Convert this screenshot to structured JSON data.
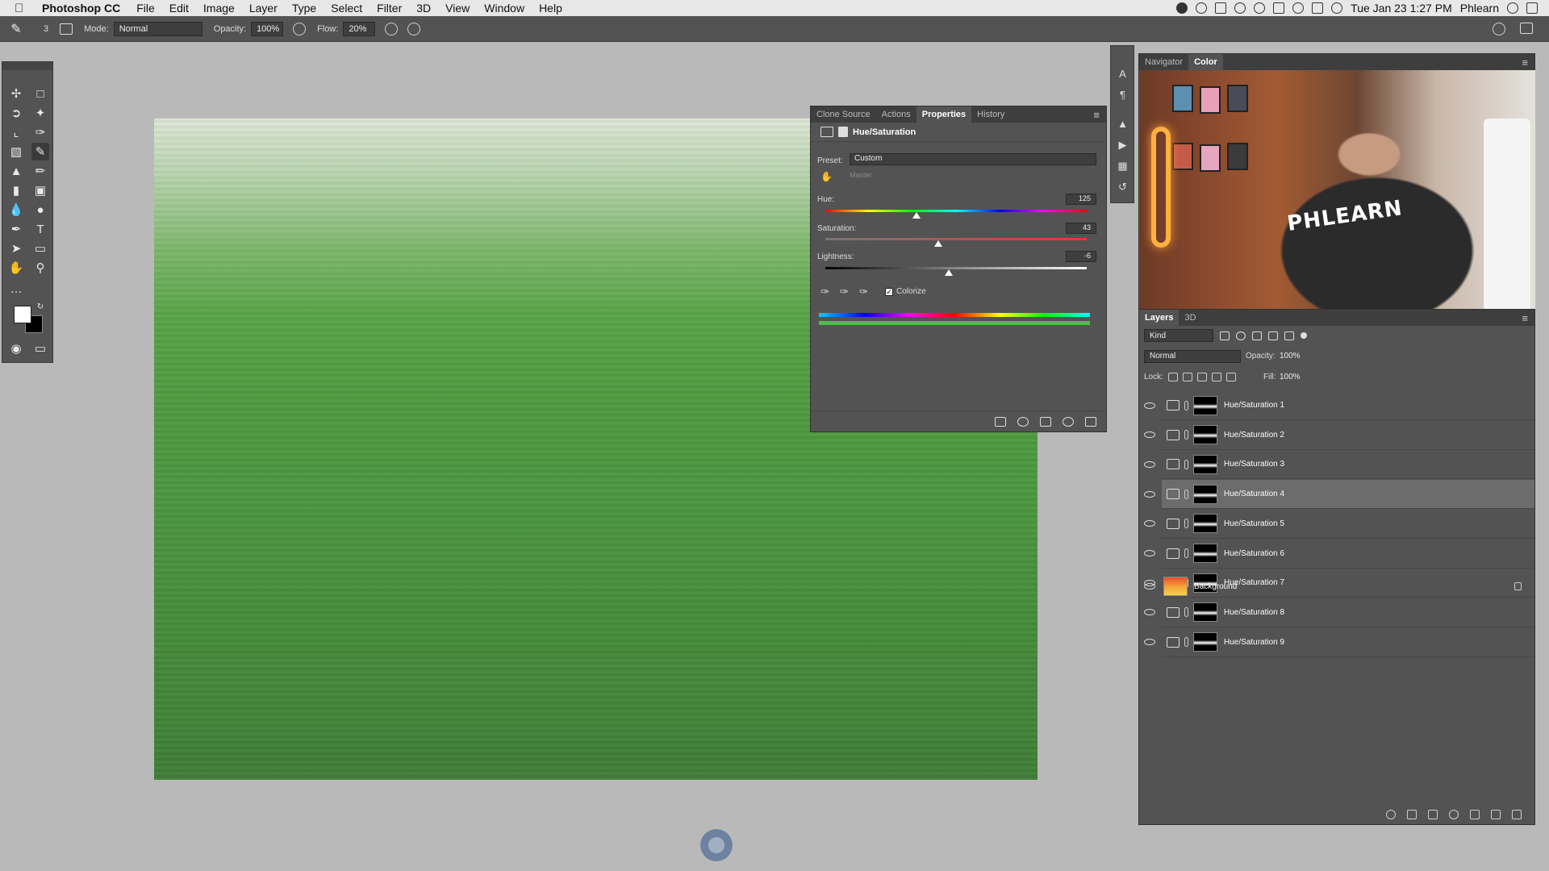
{
  "menubar": {
    "app_name": "Photoshop CC",
    "items": [
      "File",
      "Edit",
      "Image",
      "Layer",
      "Type",
      "Select",
      "Filter",
      "3D",
      "View",
      "Window",
      "Help"
    ],
    "clock": "Tue Jan 23  1:27 PM",
    "user": "Phlearn"
  },
  "options": {
    "brush_size": "3",
    "mode_label": "Mode:",
    "mode_value": "Normal",
    "opacity_label": "Opacity:",
    "opacity_value": "100%",
    "flow_label": "Flow:",
    "flow_value": "20%"
  },
  "properties": {
    "tabs": [
      "Clone Source",
      "Actions",
      "Properties",
      "History"
    ],
    "active_tab": "Properties",
    "title": "Hue/Saturation",
    "preset_label": "Preset:",
    "preset_value": "Custom",
    "channel_value": "Master",
    "hue_label": "Hue:",
    "hue_value": "125",
    "saturation_label": "Saturation:",
    "saturation_value": "43",
    "lightness_label": "Lightness:",
    "lightness_value": "-6",
    "colorize_label": "Colorize",
    "colorize_checked": true
  },
  "navigator": {
    "tabs": [
      "Navigator",
      "Color"
    ],
    "active_tab": "Color",
    "video_shirt_text": "PHLEARN"
  },
  "layers": {
    "tabs": [
      "Layers",
      "3D"
    ],
    "kind_label": "Kind",
    "blend_mode": "Normal",
    "opacity_label": "Opacity:",
    "opacity_value": "100%",
    "lock_label": "Lock:",
    "fill_label": "Fill:",
    "fill_value": "100%",
    "items": [
      {
        "name": "Hue/Saturation 1",
        "selected": false
      },
      {
        "name": "Hue/Saturation 2",
        "selected": false
      },
      {
        "name": "Hue/Saturation 3",
        "selected": false
      },
      {
        "name": "Hue/Saturation 4",
        "selected": true
      },
      {
        "name": "Hue/Saturation 5",
        "selected": false
      },
      {
        "name": "Hue/Saturation 6",
        "selected": false
      },
      {
        "name": "Hue/Saturation 7",
        "selected": false
      },
      {
        "name": "Hue/Saturation 8",
        "selected": false
      },
      {
        "name": "Hue/Saturation 9",
        "selected": false
      }
    ],
    "background_name": "Background"
  },
  "colors": {
    "panel": "#535353",
    "canvas_green": "#4b9640"
  }
}
